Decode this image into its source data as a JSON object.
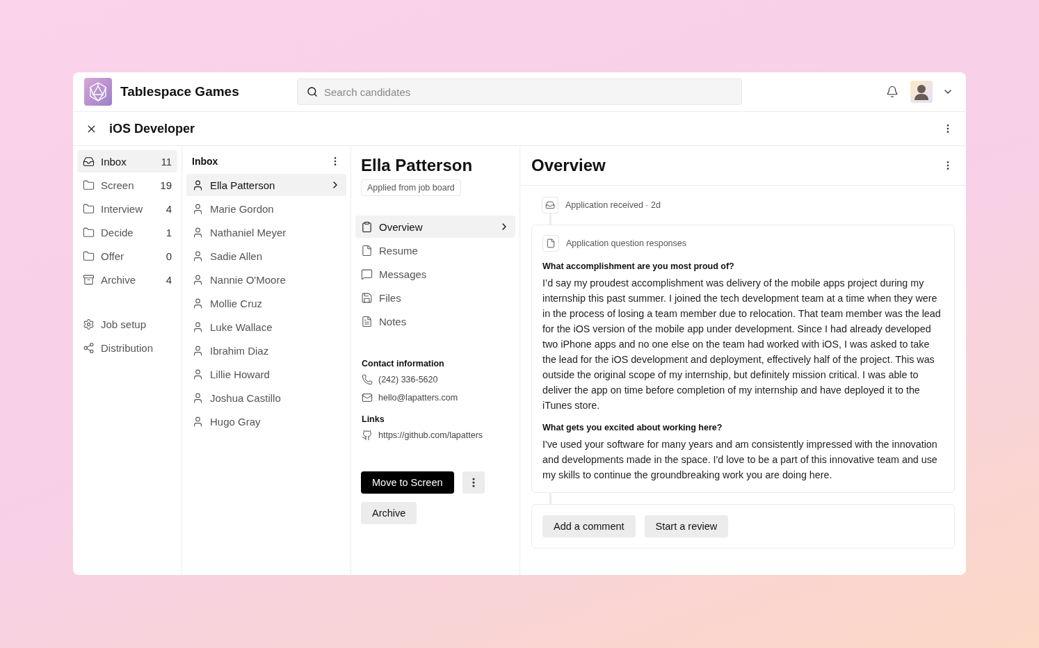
{
  "header": {
    "brand": "Tablespace Games",
    "search": {
      "placeholder": "Search candidates"
    }
  },
  "job": {
    "title": "iOS Developer"
  },
  "stages": [
    {
      "kind": "inbox",
      "label": "Inbox",
      "count": "11",
      "selected": true
    },
    {
      "kind": "folder",
      "label": "Screen",
      "count": "19",
      "selected": false
    },
    {
      "kind": "folder",
      "label": "Interview",
      "count": "4",
      "selected": false
    },
    {
      "kind": "folder",
      "label": "Decide",
      "count": "1",
      "selected": false
    },
    {
      "kind": "folder",
      "label": "Offer",
      "count": "0",
      "selected": false
    },
    {
      "kind": "archive",
      "label": "Archive",
      "count": "4",
      "selected": false
    }
  ],
  "settings": [
    {
      "kind": "gear",
      "label": "Job setup"
    },
    {
      "kind": "share",
      "label": "Distribution"
    }
  ],
  "candidates": {
    "title": "Inbox",
    "items": [
      {
        "name": "Ella Patterson",
        "selected": true
      },
      {
        "name": "Marie Gordon",
        "selected": false
      },
      {
        "name": "Nathaniel Meyer",
        "selected": false
      },
      {
        "name": "Sadie Allen",
        "selected": false
      },
      {
        "name": "Nannie O'Moore",
        "selected": false
      },
      {
        "name": "Mollie Cruz",
        "selected": false
      },
      {
        "name": "Luke Wallace",
        "selected": false
      },
      {
        "name": "Ibrahim Diaz",
        "selected": false
      },
      {
        "name": "Lillie Howard",
        "selected": false
      },
      {
        "name": "Joshua Castillo",
        "selected": false
      },
      {
        "name": "Hugo Gray",
        "selected": false
      }
    ]
  },
  "profile": {
    "name": "Ella Patterson",
    "source": "Applied from job board",
    "nav": [
      {
        "kind": "clipboard",
        "label": "Overview",
        "selected": true
      },
      {
        "kind": "file",
        "label": "Resume",
        "selected": false
      },
      {
        "kind": "message",
        "label": "Messages",
        "selected": false
      },
      {
        "kind": "save",
        "label": "Files",
        "selected": false
      },
      {
        "kind": "notes",
        "label": "Notes",
        "selected": false
      }
    ],
    "contact_title": "Contact information",
    "contacts": [
      {
        "kind": "phone",
        "value": "(242) 336-5620"
      },
      {
        "kind": "mail",
        "value": "hello@lapatters.com"
      }
    ],
    "links_title": "Links",
    "links": [
      {
        "kind": "github",
        "value": "https://github.com/lapatters"
      }
    ],
    "primary_action": "Move to Screen",
    "secondary_action": "Archive"
  },
  "overview": {
    "title": "Overview",
    "event": "Application received · 2d",
    "responses_title": "Application question responses",
    "qa": [
      {
        "question": "What accomplishment are you most proud of?",
        "answer": "I’d say my proudest accomplishment was delivery of the mobile apps project during my internship this past summer. I joined the tech development team at a time when they were in the process of losing a team member due to relocation. That team member was the lead for the iOS version of the mobile app under development. Since I had already developed two iPhone apps and no one else on the team had worked with iOS, I was asked to take the lead for the iOS development and deployment, effectively half of the project. This was outside the original scope of my internship, but definitely mission critical. I was able to deliver the app on time before completion of my internship and have deployed it to the iTunes store."
      },
      {
        "question": "What gets you excited about working here?",
        "answer": "I've used your software for many years and am consistently impressed with the innovation and developments made in the space. I'd love to be a part of this innovative team and use my skills to continue the groundbreaking work you are doing here."
      }
    ],
    "actions": [
      "Add a comment",
      "Start a review"
    ]
  }
}
